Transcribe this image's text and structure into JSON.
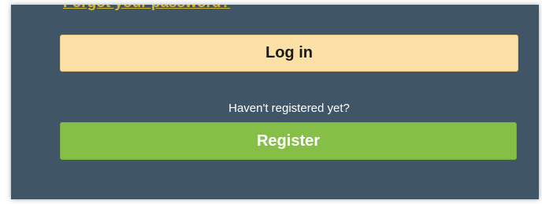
{
  "form": {
    "forgot_password_label": "Forgot your password?",
    "login_button_label": "Log in",
    "register_prompt": "Haven't registered yet?",
    "register_button_label": "Register"
  },
  "colors": {
    "panel_background": "#405667",
    "login_button": "#fde0a6",
    "register_button": "#85bf47",
    "link": "#d4b73b"
  }
}
